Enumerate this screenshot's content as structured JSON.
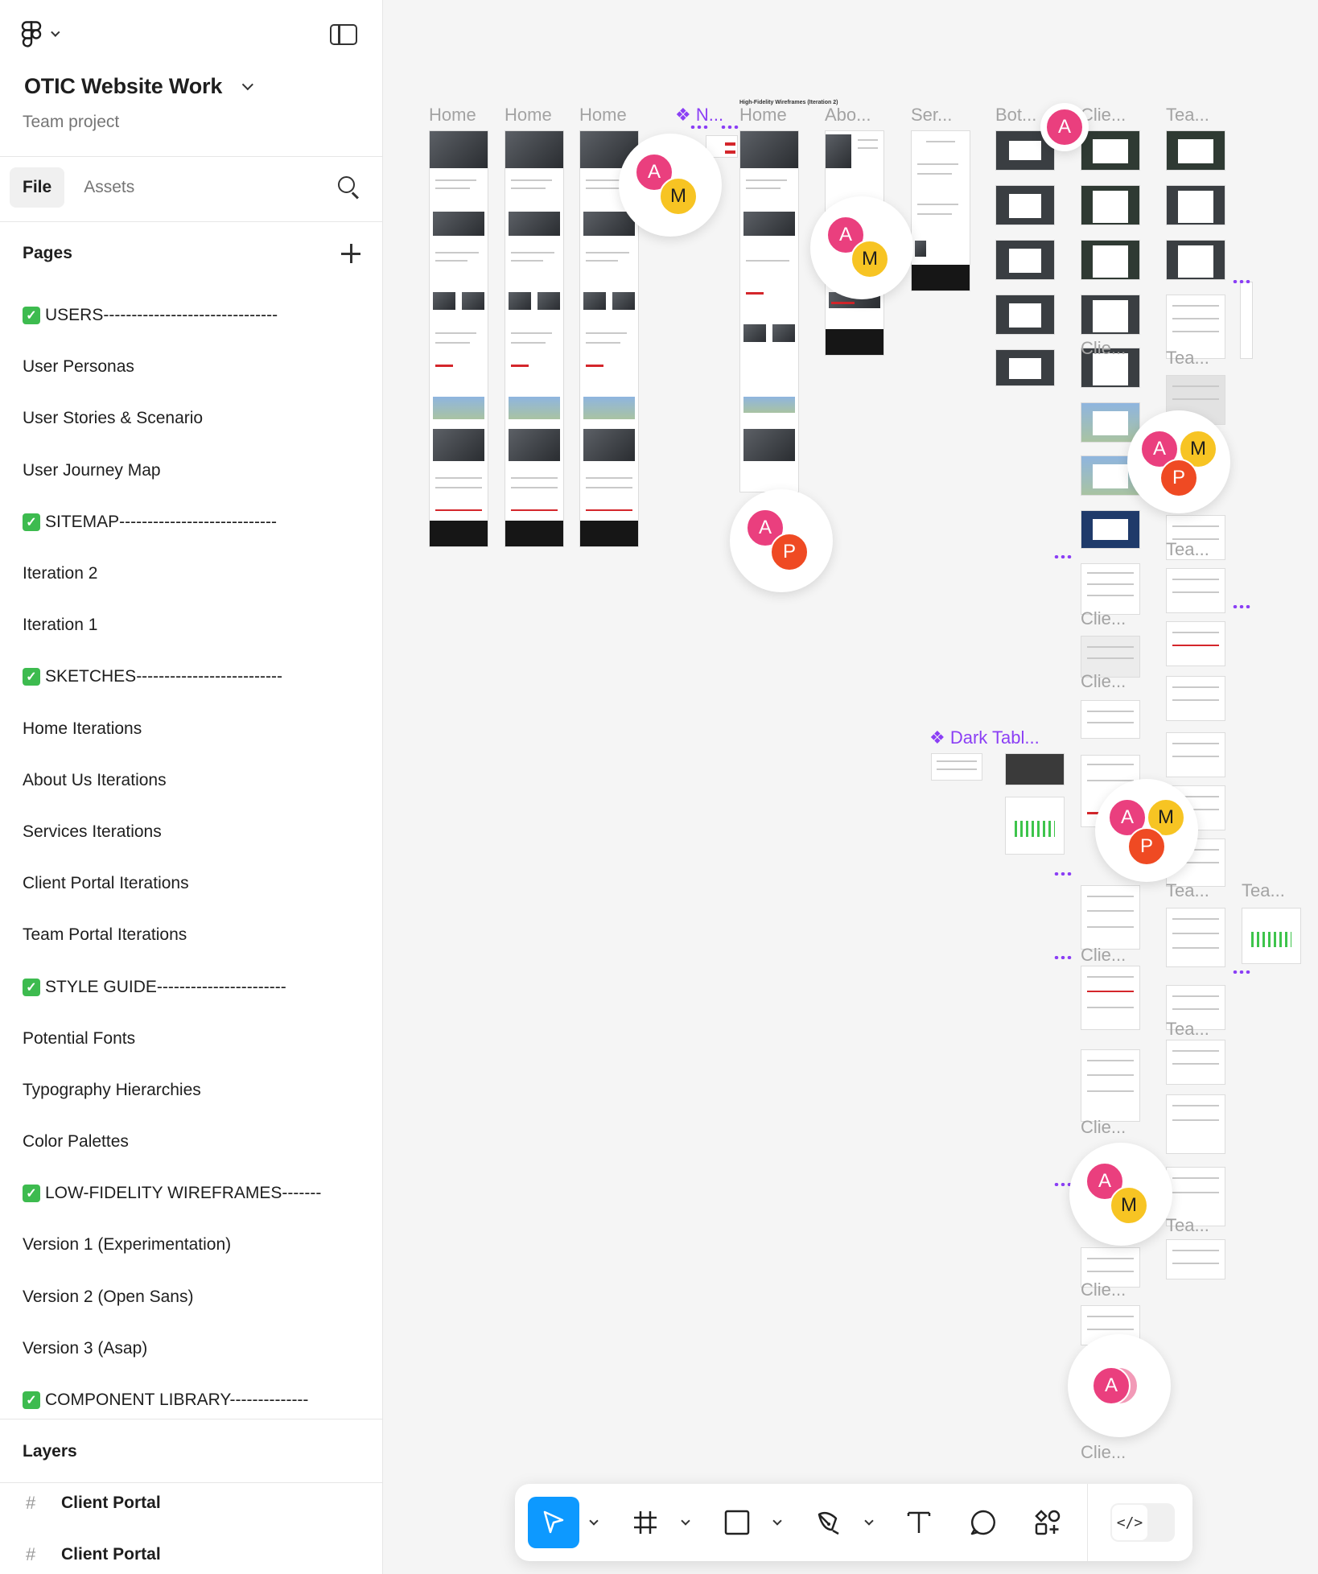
{
  "file": {
    "name": "OTIC Website Work",
    "subtitle": "Team project"
  },
  "tabs": [
    {
      "label": "File"
    },
    {
      "label": "Assets"
    }
  ],
  "pages": {
    "title": "Pages",
    "items": [
      {
        "label": "USERS-------------------------------",
        "section": true
      },
      {
        "label": "User Personas"
      },
      {
        "label": "User Stories & Scenario"
      },
      {
        "label": "User Journey Map"
      },
      {
        "label": "SITEMAP----------------------------",
        "section": true
      },
      {
        "label": "Iteration 2"
      },
      {
        "label": "Iteration 1"
      },
      {
        "label": "SKETCHES--------------------------",
        "section": true
      },
      {
        "label": "Home Iterations"
      },
      {
        "label": "About Us Iterations"
      },
      {
        "label": "Services Iterations"
      },
      {
        "label": "Client Portal Iterations"
      },
      {
        "label": "Team Portal Iterations"
      },
      {
        "label": "STYLE GUIDE-----------------------",
        "section": true
      },
      {
        "label": "Potential Fonts"
      },
      {
        "label": "Typography Hierarchies"
      },
      {
        "label": "Color Palettes"
      },
      {
        "label": "LOW-FIDELITY WIREFRAMES-------",
        "section": true
      },
      {
        "label": "Version 1 (Experimentation)"
      },
      {
        "label": "Version 2 (Open Sans)"
      },
      {
        "label": "Version 3 (Asap)"
      },
      {
        "label": "COMPONENT LIBRARY--------------",
        "section": true
      }
    ]
  },
  "layers": {
    "title": "Layers",
    "items": [
      {
        "label": "Client Portal"
      },
      {
        "label": "Client Portal"
      }
    ]
  },
  "canvas": {
    "frame_labels": {
      "home1": "Home",
      "home2": "Home",
      "home3": "Home",
      "component_n": "N...",
      "hifi_title": "High-Fidelity Wireframes (Iteration 2)",
      "home4": "Home",
      "about": "Abo...",
      "services": "Ser...",
      "bot": "Bot...",
      "clie": "Clie...",
      "tea": "Tea...",
      "dark_table": "Dark Tabl...",
      "tea_far": "Tea..."
    },
    "avatar_letters": {
      "a": "A",
      "m": "M",
      "p": "P"
    }
  },
  "toolbar": {
    "tools": [
      "move-tool",
      "frame-tool",
      "shape-tool",
      "pen-tool",
      "text-tool",
      "comment-tool",
      "actions-tool"
    ],
    "dev_mode_label": "</>"
  },
  "colors": {
    "accent": "#0d99ff",
    "component_purple": "#8b3ff5",
    "check_green": "#3dbb4f",
    "avatar_a": "#ea3f7e",
    "avatar_m": "#f7c423",
    "avatar_p": "#ef4a23"
  }
}
